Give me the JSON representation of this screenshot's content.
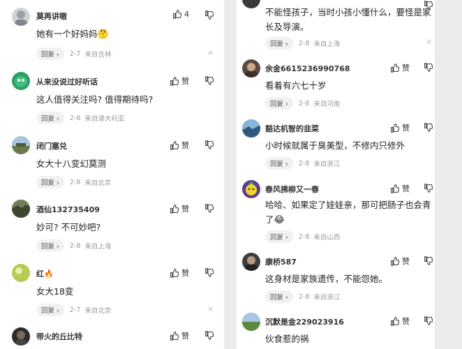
{
  "left": [
    {
      "user": "莫再讲嗷",
      "like": "4",
      "text": "她有一个好妈妈",
      "emoji": "🤔",
      "date": "2-7",
      "loc": "来自吉林"
    },
    {
      "user": "从来没说过好听话",
      "like": "赞",
      "text": "这人值得关注吗? 值得期待吗?",
      "date": "2-8",
      "loc": "来自澳大利亚"
    },
    {
      "user": "闭门塞兑",
      "like": "赞",
      "text": "女大十八变幻莫测",
      "date": "2-8",
      "loc": "来自北京"
    },
    {
      "user": "酒仙132735409",
      "like": "赞",
      "text": "妙可? 不可妙吧?",
      "date": "2-8",
      "loc": "来自上海"
    },
    {
      "user": "红🔥",
      "like": "赞",
      "text": "女大18变",
      "date": "2-7",
      "loc": "来自北京"
    },
    {
      "user": "带火的丘比特",
      "like": "赞"
    }
  ],
  "right": [
    {
      "text_lines": [
        "不能怪孩子，当时小孩小懂什么，要怪是家",
        "长及导演。"
      ],
      "date": "2-8",
      "loc": "来自上海"
    },
    {
      "user": "余金6615236990768",
      "like": "赞",
      "text_lines": [
        "看着有六七十岁"
      ],
      "date": "2-8",
      "loc": "来自河南"
    },
    {
      "user": "豁达机智的韭菜",
      "like": "赞",
      "text_lines": [
        "小时候就属于臭美型，不修内只修外"
      ],
      "date": "2-8",
      "loc": "来自浙江"
    },
    {
      "user": "春风拂柳又一春",
      "like": "赞",
      "text_lines": [
        "哈哈、如果定了娃娃亲，那可把肠子也会青",
        "了"
      ],
      "emoji": "😂",
      "date": "2-8",
      "loc": "来自山西"
    },
    {
      "user": "康桥587",
      "like": "赞",
      "text_lines": [
        "这身材是家族遗传，不能怨她。"
      ],
      "date": "2-8",
      "loc": "来自浙江"
    },
    {
      "user": "沉默是金229023916",
      "like": "赞",
      "text_lines": [
        "伙食惹的祸"
      ]
    }
  ],
  "reply_label": "回复",
  "reply_arrow": "›",
  "close_glyph": "×",
  "icons": {
    "like": "thumbs-up-icon",
    "dislike": "thumbs-down-icon",
    "close": "close-icon"
  },
  "colors": {
    "background": "#ececec",
    "card": "#ffffff",
    "meta_text": "#999999",
    "reply_bg": "#f1f1f1"
  }
}
